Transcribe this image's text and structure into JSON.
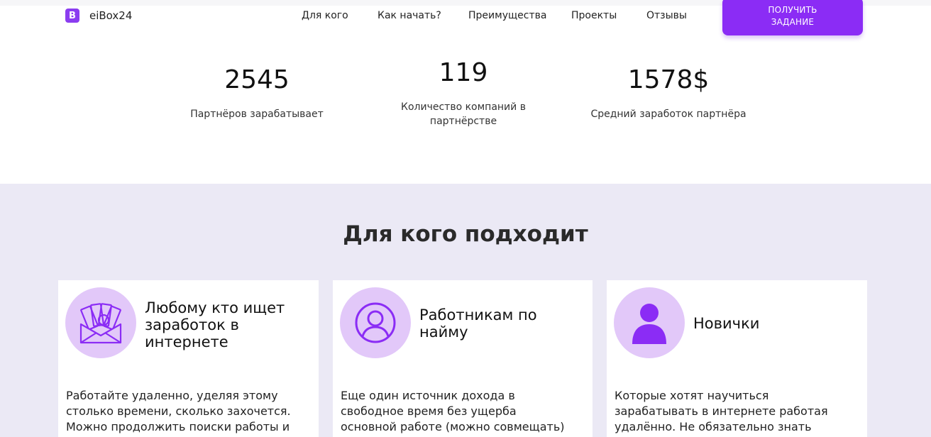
{
  "header": {
    "logo_letter": "B",
    "logo_text": "eiBox24",
    "nav": [
      "Для кого",
      "Как начать?",
      "Преимущества",
      "Проекты",
      "Отзывы"
    ],
    "cta_line1": "ПОЛУЧИТЬ",
    "cta_line2": "ЗАДАНИЕ"
  },
  "stats": [
    {
      "value": "2545",
      "label_line1": "Партнёров зарабатывает",
      "label_line2": ""
    },
    {
      "value": "119",
      "label_line1": "Количество компаний в",
      "label_line2": "партнёрстве"
    },
    {
      "value": "1578$",
      "label_line1": "Средний заработок партнёра",
      "label_line2": ""
    }
  ],
  "section": {
    "title": "Для кого подходит",
    "cards": [
      {
        "title": [
          "Любому кто ищет",
          "заработок в",
          "интернете"
        ],
        "icon": "money-envelope-icon",
        "text": "Работайте удаленно, уделяя этому столько времени, сколько захочется. Можно продолжить поиски работы и"
      },
      {
        "title": [
          "Работникам по",
          "найму"
        ],
        "icon": "person-circle-icon",
        "text": "Еще один источник дохода в свободное время без ущерба основной работе (можно совмещать)"
      },
      {
        "title": [
          "Новички"
        ],
        "icon": "person-icon",
        "text": "Которые хотят научиться зарабатывать в интернете работая удалённо. Не обязательно знать языки"
      }
    ]
  },
  "colors": {
    "accent": "#8b2cf5",
    "icon_bg": "#e2c8f9",
    "section_bg": "#ebe9f5"
  }
}
